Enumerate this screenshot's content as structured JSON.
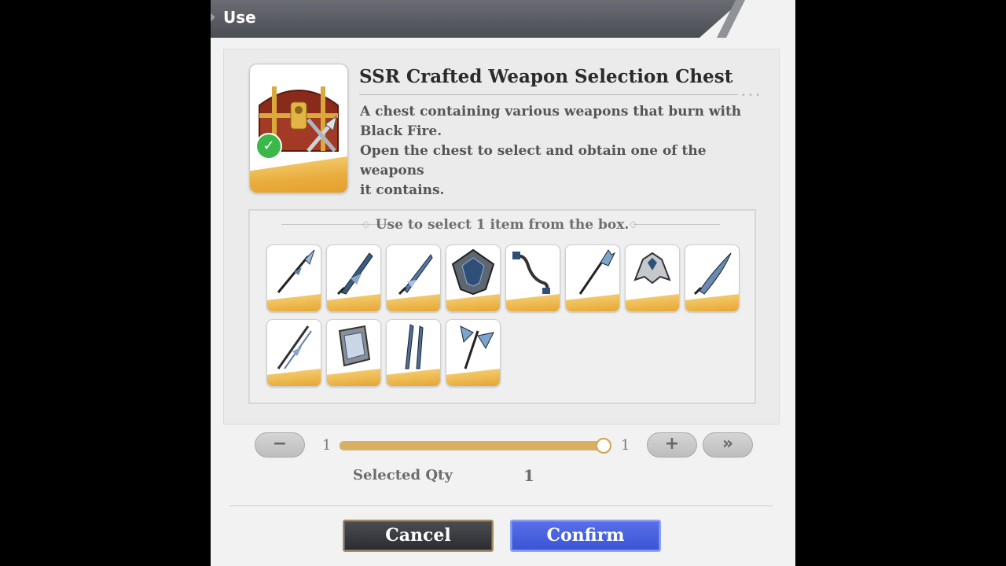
{
  "dialog": {
    "title": "Use"
  },
  "item": {
    "name": "SSR Crafted Weapon Selection Chest",
    "description": [
      "A chest containing various weapons that burn with",
      "Black Fire.",
      "Open the chest to select and obtain one of the weapons",
      "it contains."
    ],
    "icon": "treasure-chest-icon",
    "owned_check_icon": "checkmark-icon"
  },
  "selection": {
    "caption": "Use to select 1 item from the box.",
    "options": [
      {
        "icon": "spear-icon"
      },
      {
        "icon": "greatsword-icon"
      },
      {
        "icon": "sword-icon"
      },
      {
        "icon": "shield-icon"
      },
      {
        "icon": "chain-whip-icon"
      },
      {
        "icon": "trident-staff-icon"
      },
      {
        "icon": "gauntlet-icon"
      },
      {
        "icon": "curved-sword-icon"
      },
      {
        "icon": "lance-icon"
      },
      {
        "icon": "tome-icon"
      },
      {
        "icon": "dual-blades-icon"
      },
      {
        "icon": "battle-axe-icon"
      }
    ]
  },
  "quantity": {
    "min": "1",
    "max": "1",
    "value_fraction": 1.0,
    "minus_label": "−",
    "plus_label": "+",
    "max_label": "»",
    "selected_label": "Selected Qty",
    "selected_value": "1"
  },
  "buttons": {
    "cancel": "Cancel",
    "confirm": "Confirm"
  },
  "colors": {
    "confirm": "#4a62de",
    "cancel": "#3a3c41",
    "gold": "#e9ad3d"
  }
}
